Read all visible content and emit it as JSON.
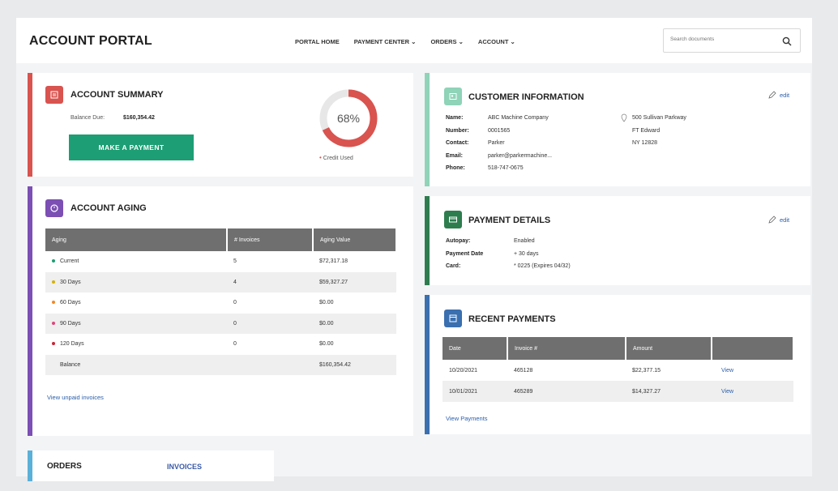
{
  "header": {
    "title": "ACCOUNT PORTAL",
    "nav": [
      "PORTAL HOME",
      "PAYMENT CENTER ⌄",
      "ORDERS ⌄",
      "ACCOUNT ⌄"
    ],
    "search_placeholder": "Search documents"
  },
  "summary": {
    "title": "ACCOUNT SUMMARY",
    "balance_label": "Balance Due:",
    "balance_value": "$160,354.42",
    "button": "MAKE A PAYMENT",
    "credit_percent_text": "68%",
    "credit_fraction": 0.68,
    "credit_label": "Credit Used"
  },
  "aging": {
    "title": "ACCOUNT AGING",
    "columns": [
      "Aging",
      "# Invoices",
      "Aging Value"
    ],
    "rows": [
      {
        "label": "Current",
        "invoices": "5",
        "value": "$72,317.18",
        "color": "#1d9e74"
      },
      {
        "label": "30 Days",
        "invoices": "4",
        "value": "$59,327.27",
        "color": "#d4b106"
      },
      {
        "label": "60 Days",
        "invoices": "0",
        "value": "$0.00",
        "color": "#f0882b"
      },
      {
        "label": "90 Days",
        "invoices": "0",
        "value": "$0.00",
        "color": "#e0457b"
      },
      {
        "label": "120 Days",
        "invoices": "0",
        "value": "$0.00",
        "color": "#cc2233"
      },
      {
        "label": "Balance",
        "invoices": "",
        "value": "$160,354.42",
        "color": ""
      }
    ],
    "link": "View unpaid invoices"
  },
  "customer": {
    "title": "CUSTOMER INFORMATION",
    "edit": "edit",
    "fields": [
      {
        "k": "Name:",
        "v": "ABC Machine Company"
      },
      {
        "k": "Number:",
        "v": "0001565"
      },
      {
        "k": "Contact:",
        "v": "Parker"
      },
      {
        "k": "Email:",
        "v": "parker@parkermachine..."
      },
      {
        "k": "Phone:",
        "v": "518-747-0675"
      }
    ],
    "address": [
      "500 Sullivan Parkway",
      "FT Edward",
      "NY 12828"
    ]
  },
  "payment_details": {
    "title": "PAYMENT DETAILS",
    "edit": "edit",
    "fields": [
      {
        "k": "Autopay:",
        "v": "Enabled"
      },
      {
        "k": "Payment Date",
        "v": "+ 30 days"
      },
      {
        "k": "Card:",
        "v": "* 0225 (Expires 04/32)"
      }
    ]
  },
  "recent": {
    "title": "RECENT PAYMENTS",
    "columns": [
      "Date",
      "Invoice #",
      "Amount",
      ""
    ],
    "rows": [
      {
        "date": "10/20/2021",
        "invoice": "465128",
        "amount": "$22,377.15",
        "action": "View"
      },
      {
        "date": "10/01/2021",
        "invoice": "465289",
        "amount": "$14,327.27",
        "action": "View"
      }
    ],
    "link": "View Payments"
  },
  "tabs": {
    "orders": "ORDERS",
    "invoices": "INVOICES"
  },
  "colors": {
    "summary": "#d9534f",
    "aging": "#7b4fb3",
    "customer": "#8fd3b8",
    "payment": "#2e7d4f",
    "recent": "#3a6fb0",
    "tabs": "#5ab0d8",
    "donut_track": "#e7e7e7"
  }
}
